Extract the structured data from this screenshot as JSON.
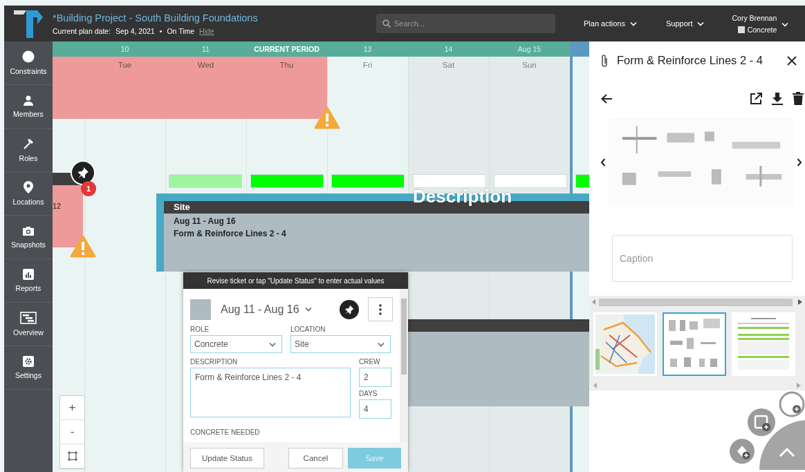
{
  "header": {
    "title": "*Building Project - South Building Foundations",
    "plan_date_label": "Current plan date:",
    "plan_date": "Sep 4, 2021",
    "separator": "•",
    "status": "On Time",
    "hide_link": "Hide",
    "search": {
      "placeholder": "Search..."
    },
    "menus": [
      {
        "label": "Plan actions"
      },
      {
        "label": "Support"
      }
    ],
    "user": {
      "name": "Cory Brennan",
      "role": "Concrete"
    }
  },
  "sidebar": {
    "items": [
      {
        "label": "Constraints"
      },
      {
        "label": "Members"
      },
      {
        "label": "Roles"
      },
      {
        "label": "Locations"
      },
      {
        "label": "Snapshots"
      },
      {
        "label": "Reports"
      },
      {
        "label": "Overview"
      },
      {
        "label": "Settings"
      }
    ]
  },
  "schedule": {
    "periods": [
      {
        "label": "10",
        "current": false
      },
      {
        "label": "11",
        "current": false
      },
      {
        "label": "CURRENT PERIOD",
        "current": true
      },
      {
        "label": "13",
        "current": false
      },
      {
        "label": "14",
        "current": false
      },
      {
        "label": "Aug 15",
        "current": false
      }
    ],
    "days": [
      {
        "label": "Tue",
        "weekend": false
      },
      {
        "label": "Wed",
        "weekend": false
      },
      {
        "label": "Thu",
        "weekend": false
      },
      {
        "label": "Fri",
        "weekend": false
      },
      {
        "label": "Sat",
        "weekend": true
      },
      {
        "label": "Sun",
        "weekend": true
      }
    ],
    "status_bars": [
      {
        "color": "#9ef59e"
      },
      {
        "color": "#00ff00"
      },
      {
        "color": "#00ff00"
      },
      {
        "color": "#ffffff"
      },
      {
        "color": "#ffffff"
      },
      {
        "color": "#00ff00"
      }
    ],
    "top_ticket": {
      "warning": true
    },
    "left_ticket": {
      "label": "12",
      "badge": "1",
      "warning": true
    },
    "selected_ticket": {
      "location": "Site",
      "dates": "Aug 11 - Aug 16",
      "description": "Form & Reinforce Lines 2 - 4"
    },
    "overlay_label": "Description",
    "zoom_controls": [
      "+",
      "-"
    ]
  },
  "dialog": {
    "banner": "Revise ticket or tap \"Update Status\" to enter actual values",
    "dates": "Aug 11 - Aug 16",
    "role": {
      "label": "ROLE",
      "value": "Concrete"
    },
    "location": {
      "label": "LOCATION",
      "value": "Site"
    },
    "description": {
      "label": "DESCRIPTION",
      "value": "Form & Reinforce Lines 2 - 4"
    },
    "crew": {
      "label": "CREW",
      "value": "2"
    },
    "days": {
      "label": "DAYS",
      "value": "4"
    },
    "concrete_label": "CONCRETE NEEDED",
    "buttons": [
      {
        "label": "Update Status",
        "kind": "secondary",
        "disabled": false
      },
      {
        "label": "Cancel",
        "kind": "secondary",
        "disabled": false
      },
      {
        "label": "Save",
        "kind": "primary",
        "disabled": true
      }
    ]
  },
  "panel": {
    "title": "Form & Reinforce Lines 2 - 4",
    "caption": {
      "placeholder": "Caption"
    },
    "thumbnails": [
      {
        "kind": "map",
        "selected": false
      },
      {
        "kind": "drawing",
        "selected": true
      },
      {
        "kind": "form",
        "selected": false
      }
    ]
  }
}
